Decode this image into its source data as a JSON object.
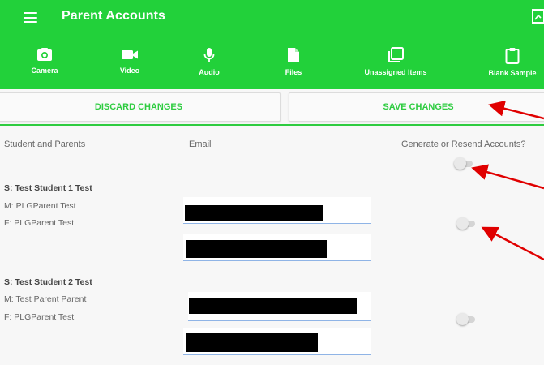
{
  "app": {
    "title": "Parent Accounts"
  },
  "toolbar": {
    "items": [
      {
        "label": "Camera",
        "icon": "camera-icon"
      },
      {
        "label": "Video",
        "icon": "video-icon"
      },
      {
        "label": "Audio",
        "icon": "microphone-icon"
      },
      {
        "label": "Files",
        "icon": "file-icon"
      },
      {
        "label": "Unassigned Items",
        "icon": "unassigned-items-icon"
      },
      {
        "label": "Blank Sample",
        "icon": "clipboard-icon"
      }
    ]
  },
  "actions": {
    "discard": "DISCARD CHANGES",
    "save": "SAVE CHANGES"
  },
  "table": {
    "headers": {
      "student": "Student and Parents",
      "email": "Email",
      "generate": "Generate or Resend Accounts?"
    },
    "students": [
      {
        "name": "S: Test Student 1 Test",
        "parents": [
          "M: PLGParent Test",
          "F: PLGParent Test"
        ]
      },
      {
        "name": "S: Test Student 2 Test",
        "parents": [
          "M: Test Parent Parent",
          "F: PLGParent Test"
        ]
      }
    ]
  },
  "colors": {
    "brand": "#22d13a",
    "accent": "#2ecc40",
    "annotation": "#e00000"
  }
}
